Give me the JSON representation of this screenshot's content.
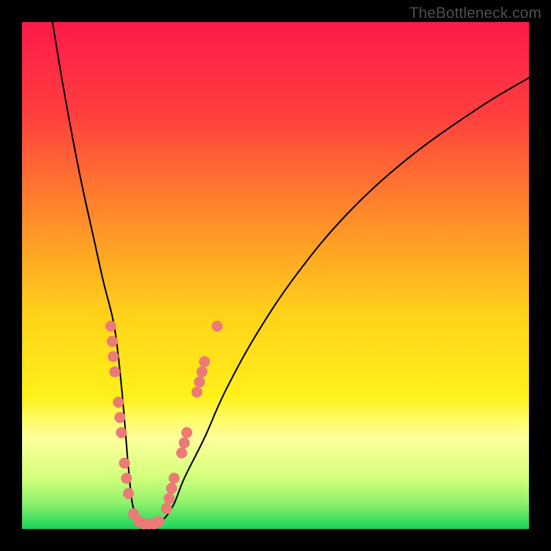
{
  "watermark": {
    "text": "TheBottleneck.com"
  },
  "colors": {
    "frame": "#000000",
    "curve_stroke": "#000000",
    "marker_fill": "#ec7a76",
    "gradient_stops": [
      {
        "pct": 0,
        "hex": "#ff1a4a"
      },
      {
        "pct": 18,
        "hex": "#ff3e3e"
      },
      {
        "pct": 38,
        "hex": "#ff8a2a"
      },
      {
        "pct": 58,
        "hex": "#ffd31a"
      },
      {
        "pct": 74,
        "hex": "#fff11a"
      },
      {
        "pct": 78,
        "hex": "#fffb60"
      },
      {
        "pct": 82,
        "hex": "#ffff9c"
      },
      {
        "pct": 90,
        "hex": "#d1ff7a"
      },
      {
        "pct": 95,
        "hex": "#8cf06a"
      },
      {
        "pct": 100,
        "hex": "#18d45a"
      }
    ]
  },
  "chart_data": {
    "type": "line",
    "title": "",
    "xlabel": "",
    "ylabel": "",
    "xlim": [
      0,
      100
    ],
    "ylim": [
      0,
      100
    ],
    "legend": "none",
    "annotations": [],
    "series": [
      {
        "name": "bottleneck-fit-curve",
        "x": [
          6,
          8,
          10,
          12,
          14,
          16,
          18,
          19,
          20,
          21,
          22,
          24,
          26,
          28,
          30,
          32,
          36,
          40,
          46,
          54,
          64,
          76,
          90,
          100
        ],
        "y": [
          100,
          88,
          77,
          67,
          58,
          49,
          41,
          34,
          24,
          12,
          4,
          1,
          1,
          2,
          5,
          10,
          18,
          27,
          38,
          50,
          62,
          73,
          83,
          89
        ]
      }
    ],
    "markers": [
      {
        "name": "cluster-left-upper",
        "points": [
          {
            "x": 17.5,
            "y": 40
          },
          {
            "x": 17.8,
            "y": 37
          },
          {
            "x": 18.0,
            "y": 34
          },
          {
            "x": 18.3,
            "y": 31
          }
        ]
      },
      {
        "name": "cluster-left-mid",
        "points": [
          {
            "x": 19.0,
            "y": 25
          },
          {
            "x": 19.3,
            "y": 22
          },
          {
            "x": 19.6,
            "y": 19
          }
        ]
      },
      {
        "name": "cluster-left-low",
        "points": [
          {
            "x": 20.2,
            "y": 13
          },
          {
            "x": 20.6,
            "y": 10
          },
          {
            "x": 21.0,
            "y": 7
          }
        ]
      },
      {
        "name": "cluster-bottom",
        "points": [
          {
            "x": 22.0,
            "y": 3
          },
          {
            "x": 23.0,
            "y": 1.5
          },
          {
            "x": 24.0,
            "y": 1
          },
          {
            "x": 25.0,
            "y": 1
          },
          {
            "x": 26.0,
            "y": 1
          },
          {
            "x": 27.0,
            "y": 1.5
          }
        ]
      },
      {
        "name": "cluster-right-low",
        "points": [
          {
            "x": 28.5,
            "y": 4
          },
          {
            "x": 29.0,
            "y": 6
          },
          {
            "x": 29.5,
            "y": 8
          },
          {
            "x": 30.0,
            "y": 10
          }
        ]
      },
      {
        "name": "cluster-right-mid",
        "points": [
          {
            "x": 31.5,
            "y": 15
          },
          {
            "x": 32.0,
            "y": 17
          },
          {
            "x": 32.5,
            "y": 19
          }
        ]
      },
      {
        "name": "cluster-right-upper",
        "points": [
          {
            "x": 34.5,
            "y": 27
          },
          {
            "x": 35.0,
            "y": 29
          },
          {
            "x": 35.5,
            "y": 31
          },
          {
            "x": 36.0,
            "y": 33
          }
        ]
      },
      {
        "name": "outlier-right",
        "points": [
          {
            "x": 38.5,
            "y": 40
          }
        ]
      }
    ],
    "marker_style": {
      "shape": "circle",
      "radius_px": 8
    }
  }
}
